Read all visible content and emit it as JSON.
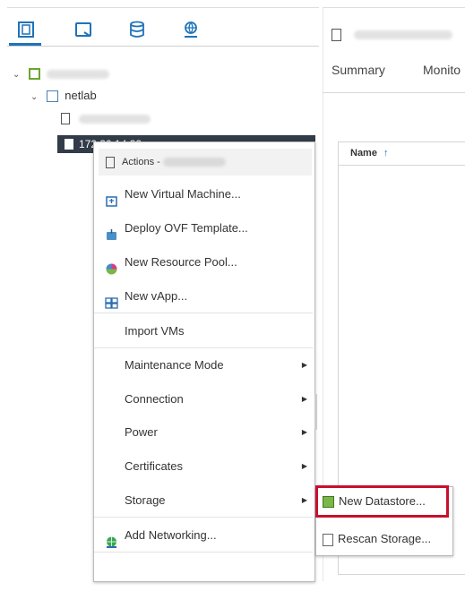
{
  "navigator": {
    "tabs": [
      "hosts-and-clusters-icon",
      "vms-and-templates-icon",
      "storage-icon",
      "networking-icon"
    ],
    "tree": {
      "datacenter_label": "netlab",
      "selected_host": "172.30.14.32"
    }
  },
  "main": {
    "tabs": [
      "Summary",
      "Monito"
    ],
    "grid": {
      "column_name": "Name",
      "sort_indicator": "↑"
    }
  },
  "context_menu": {
    "header": "Actions -",
    "items": [
      {
        "label": "New Virtual Machine...",
        "icon": "new-vm-icon"
      },
      {
        "label": "Deploy OVF Template...",
        "icon": "deploy-ovf-icon"
      },
      {
        "label": "New Resource Pool...",
        "icon": "resource-pool-icon"
      },
      {
        "label": "New vApp...",
        "icon": "vapp-icon"
      },
      {
        "label": "Import VMs"
      },
      {
        "label": "Maintenance Mode",
        "submenu": true
      },
      {
        "label": "Connection",
        "submenu": true
      },
      {
        "label": "Power",
        "submenu": true
      },
      {
        "label": "Certificates",
        "submenu": true
      },
      {
        "label": "Storage",
        "submenu": true
      },
      {
        "label": "Add Networking...",
        "icon": "add-networking-icon"
      }
    ]
  },
  "storage_submenu": {
    "items": [
      {
        "label": "New Datastore...",
        "icon": "new-datastore-icon"
      },
      {
        "label": "Rescan Storage...",
        "icon": "rescan-storage-icon"
      }
    ]
  },
  "colors": {
    "accent": "#1e73b9",
    "selected_bg": "#323c48",
    "highlight": "#c8102e"
  }
}
